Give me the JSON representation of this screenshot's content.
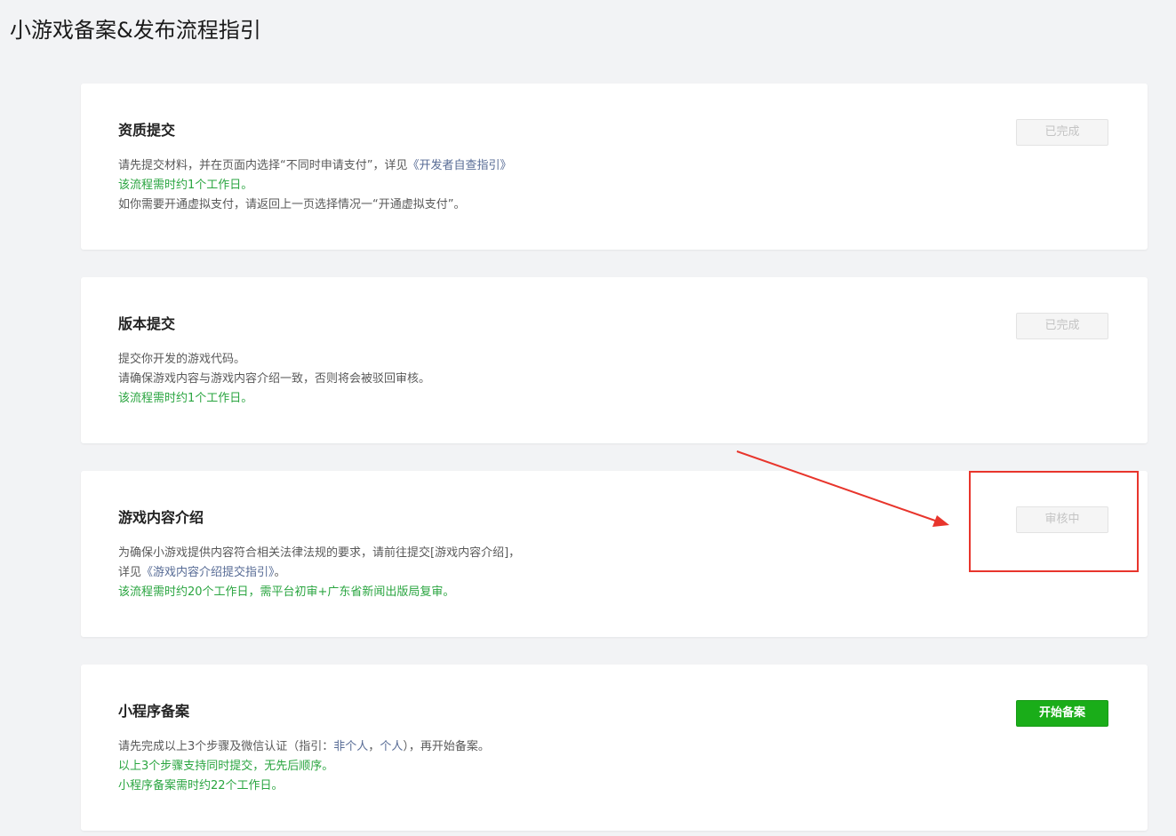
{
  "page": {
    "title": "小游戏备案&发布流程指引"
  },
  "cards": [
    {
      "title": "资质提交",
      "button": {
        "label": "已完成",
        "state": "disabled"
      },
      "lines": [
        [
          {
            "text": "请先提交材料，并在页面内选择“不同时申请支付”，详见",
            "style": "gray"
          },
          {
            "text": "《开发者自查指引》",
            "style": "link"
          }
        ],
        [
          {
            "text": "该流程需时约1个工作日。",
            "style": "green"
          }
        ],
        [
          {
            "text": "如你需要开通虚拟支付，请返回上一页选择情况一“开通虚拟支付”。",
            "style": "gray"
          }
        ]
      ]
    },
    {
      "title": "版本提交",
      "button": {
        "label": "已完成",
        "state": "disabled"
      },
      "lines": [
        [
          {
            "text": "提交你开发的游戏代码。",
            "style": "gray"
          }
        ],
        [
          {
            "text": "请确保游戏内容与游戏内容介绍一致，否则将会被驳回审核。",
            "style": "gray"
          }
        ],
        [
          {
            "text": "该流程需时约1个工作日。",
            "style": "green"
          }
        ]
      ]
    },
    {
      "title": "游戏内容介绍",
      "button": {
        "label": "审核中",
        "state": "disabled"
      },
      "lines": [
        [
          {
            "text": "为确保小游戏提供内容符合相关法律法规的要求，请前往提交[游戏内容介绍]，",
            "style": "gray"
          }
        ],
        [
          {
            "text": "详见",
            "style": "gray"
          },
          {
            "text": "《游戏内容介绍提交指引》",
            "style": "link"
          },
          {
            "text": "。",
            "style": "gray"
          }
        ],
        [
          {
            "text": "该流程需时约20个工作日，需平台初审+广东省新闻出版局复审。",
            "style": "green"
          }
        ]
      ]
    },
    {
      "title": "小程序备案",
      "button": {
        "label": "开始备案",
        "state": "primary"
      },
      "lines": [
        [
          {
            "text": "请先完成以上3个步骤及微信认证（指引：",
            "style": "gray"
          },
          {
            "text": "非个人",
            "style": "link"
          },
          {
            "text": "，",
            "style": "gray"
          },
          {
            "text": "个人",
            "style": "link"
          },
          {
            "text": "），再开始备案。",
            "style": "gray"
          }
        ],
        [
          {
            "text": "以上3个步骤支持同时提交，无先后顺序。",
            "style": "green"
          }
        ],
        [
          {
            "text": "小程序备案需时约22个工作日。",
            "style": "green"
          }
        ]
      ]
    }
  ],
  "colors": {
    "background": "#f2f3f5",
    "green_text": "#2aa540",
    "link": "#576b95",
    "primary_button": "#1aad19",
    "annotation": "#e8352c"
  }
}
